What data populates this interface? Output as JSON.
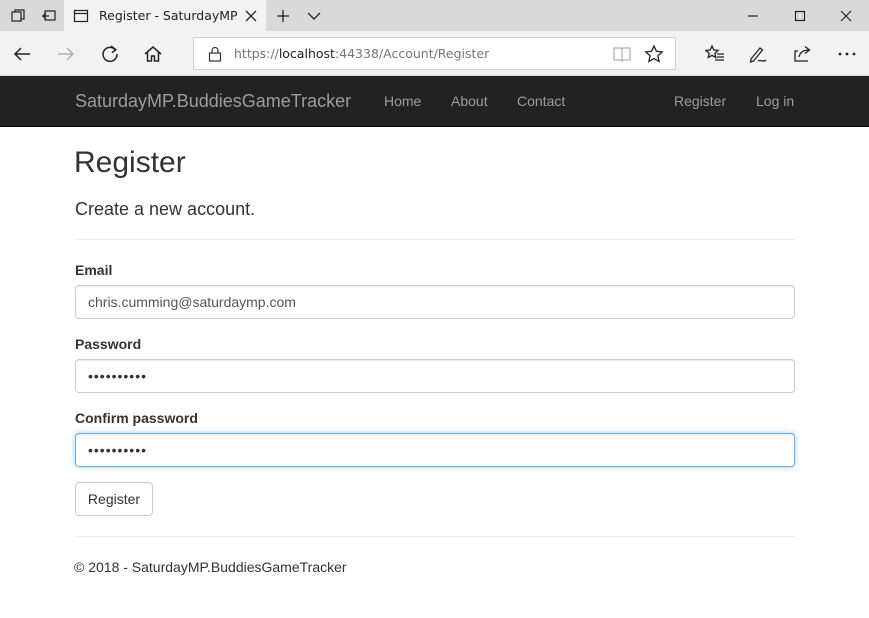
{
  "browser": {
    "tab": {
      "title": "Register - SaturdayMP.E"
    },
    "address": {
      "scheme": "https://",
      "host": "localhost",
      "rest": ":44338/Account/Register"
    }
  },
  "site": {
    "brand": "SaturdayMP.BuddiesGameTracker",
    "nav_left": [
      "Home",
      "About",
      "Contact"
    ],
    "nav_right": [
      "Register",
      "Log in"
    ]
  },
  "page": {
    "title": "Register",
    "subtitle": "Create a new account.",
    "fields": {
      "email_label": "Email",
      "email_value": "chris.cumming@saturdaymp.com",
      "password_label": "Password",
      "password_value": "••••••••••",
      "confirm_label": "Confirm password",
      "confirm_value": "••••••••••"
    },
    "submit_label": "Register",
    "footer": "© 2018 - SaturdayMP.BuddiesGameTracker"
  },
  "colors": {
    "navbar_bg": "#222222",
    "navbar_link": "#9d9d9d",
    "focus_border": "#66afe9",
    "chrome_bg": "#f2f2f2"
  }
}
